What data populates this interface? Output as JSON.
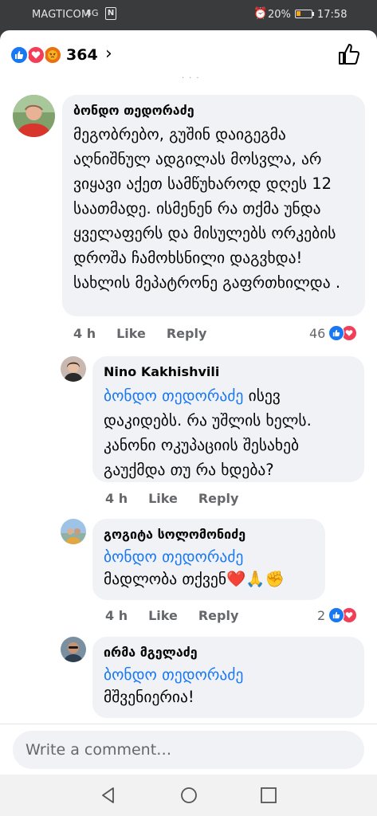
{
  "status": {
    "carrier": "MAGTICOM",
    "signal": "4G",
    "nfc": "N",
    "battery": "20%",
    "time": "17:58"
  },
  "reactions": {
    "count": "364",
    "icons": [
      "like-icon",
      "love-icon",
      "angry-icon"
    ],
    "chevron": "›"
  },
  "comments": [
    {
      "author": "ბონდო თედორაძე",
      "text": "მეგობრებო, გუშინ დაიგეგმა აღნიშნულ ადგილას მოსვლა, არ ვიყავი აქეთ სამწუხაროდ დღეს 12 საათმადე. ისმენენ რა თქმა უნდა ყველაფერს და მისულებს ორკების დროშა ჩამოხსნილი დაგვხდა! სახლის მეპატრონე გაფრთხილდა .",
      "time": "4 h",
      "like": "Like",
      "reply": "Reply",
      "reactions": "46"
    },
    {
      "author": "Nino Kakhishvili",
      "mention": "ბონდო თედორაძე",
      "text": "ისევ დაკიდებს. რა უშლის ხელს. კანონი ოკუპაციის შესახებ გაუქმდა თუ რა ხდება?",
      "time": "4 h",
      "like": "Like",
      "reply": "Reply"
    },
    {
      "author": "გოგიტა სოლომონიძე",
      "mention": "ბონდო თედორაძე",
      "text": "მადლობა თქვენ❤️🙏✊",
      "time": "4 h",
      "like": "Like",
      "reply": "Reply",
      "reactions": "2"
    },
    {
      "author": "ირმა მგელაძე",
      "mention": "ბონდო თედორაძე",
      "text": "მშვენიერია!"
    }
  ],
  "composer": {
    "placeholder": "Write a comment…"
  },
  "colors": {
    "accent": "#1877f2",
    "love": "#f33e58",
    "angry": "#e9710f",
    "bubble": "#f0f2f5"
  }
}
